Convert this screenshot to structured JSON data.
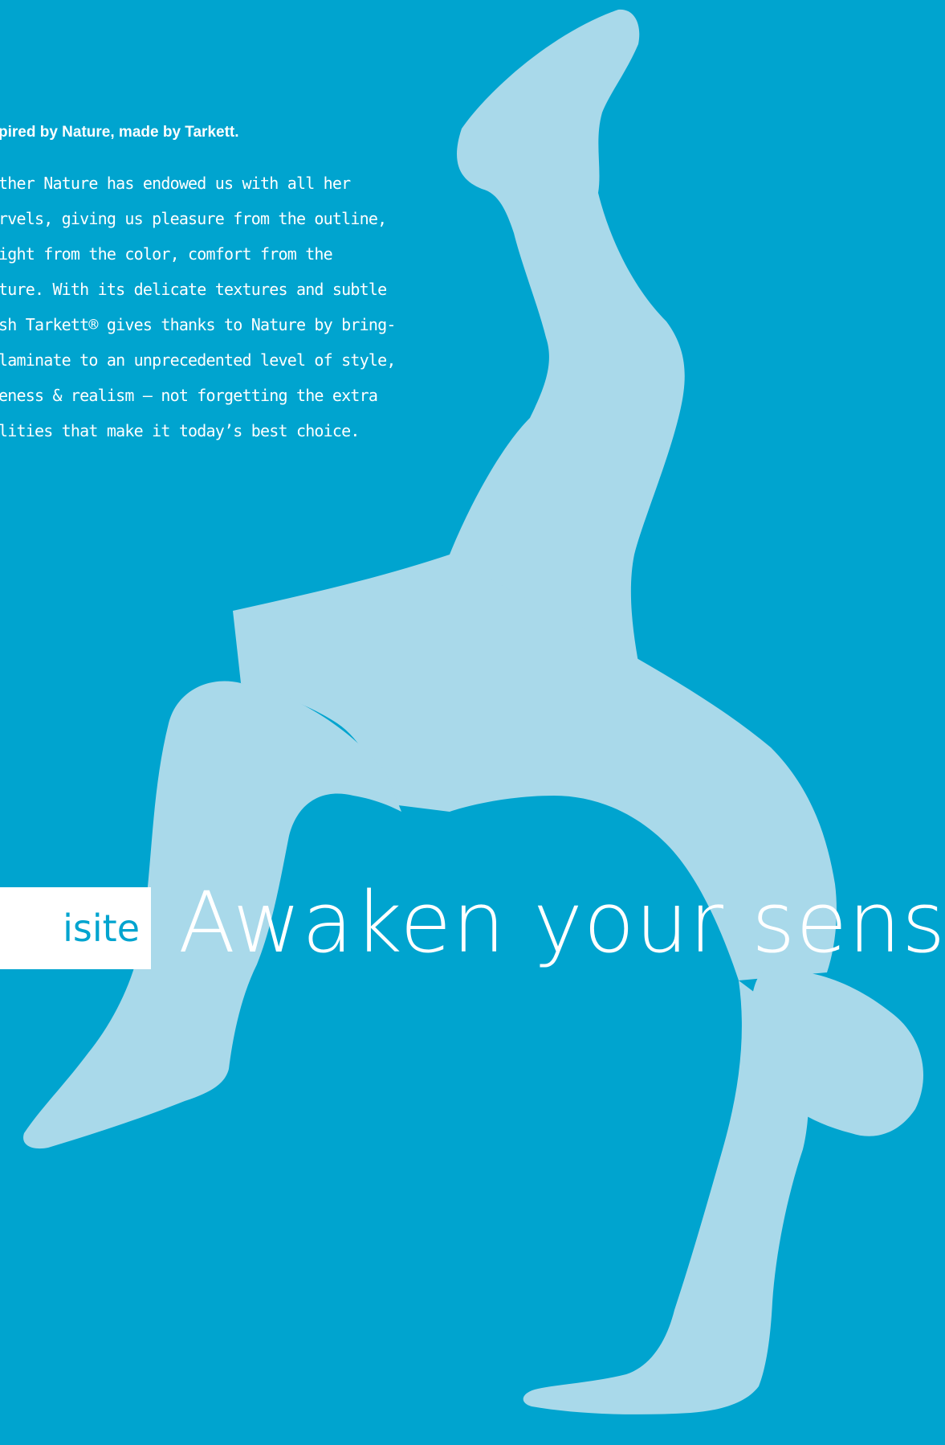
{
  "intro": {
    "heading": "pired by Nature, made by Tarkett.",
    "lines": [
      "ther Nature has endowed us with all her",
      "rvels, giving us pleasure from the outline,",
      "ight  from  the  color,  comfort  from  the",
      "ture. With its delicate textures and subtle",
      "sh  Tarkett® gives thanks to Nature by bring-",
      " laminate to an unprecedented level of style,",
      "eness & realism – not forgetting the extra",
      "lities that make it today’s best choice."
    ]
  },
  "tag": {
    "text": "isite"
  },
  "headline": {
    "text": "Awaken your sense"
  },
  "colors": {
    "background": "#00a4cf",
    "silhouette": "#a9d9ea",
    "text": "#ffffff"
  },
  "icons": {
    "silhouette": "breakdancer-silhouette-icon"
  }
}
